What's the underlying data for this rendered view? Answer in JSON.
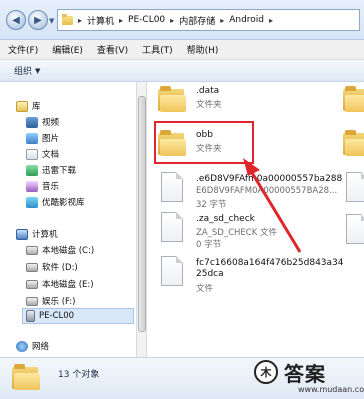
{
  "address": {
    "crumbs": [
      "计算机",
      "PE-CL00",
      "内部存储",
      "Android"
    ]
  },
  "menu": [
    "文件(F)",
    "编辑(E)",
    "查看(V)",
    "工具(T)",
    "帮助(H)"
  ],
  "command_bar": {
    "organize": "组织"
  },
  "nav": {
    "library": "库",
    "items": [
      "视频",
      "图片",
      "文档",
      "迅雷下载",
      "音乐",
      "优酷影视库"
    ],
    "computer": "计算机",
    "drives": [
      "本地磁盘 (C:)",
      "软件 (D:)",
      "本地磁盘 (E:)",
      "娱乐 (F:)",
      "PE-CL00"
    ],
    "network": "网络"
  },
  "files": [
    {
      "name": ".data",
      "type": "文件夹"
    },
    {
      "name": "obb",
      "type": "文件夹"
    },
    {
      "name": ".e6D8V9FAfm0a00000557ba288",
      "type": "E6D8V9FAFM0A00000557BA28...",
      "size": "32 字节"
    },
    {
      "name": ".za_sd_check",
      "type": "ZA_SD_CHECK 文件",
      "size": "0 字节"
    },
    {
      "name": "fc7c16608a164f476b25d843a3425dca",
      "type": "文件"
    }
  ],
  "details": {
    "count": "13 个对象"
  },
  "watermark": {
    "text": "答案",
    "url": "www.mudaan.com"
  }
}
